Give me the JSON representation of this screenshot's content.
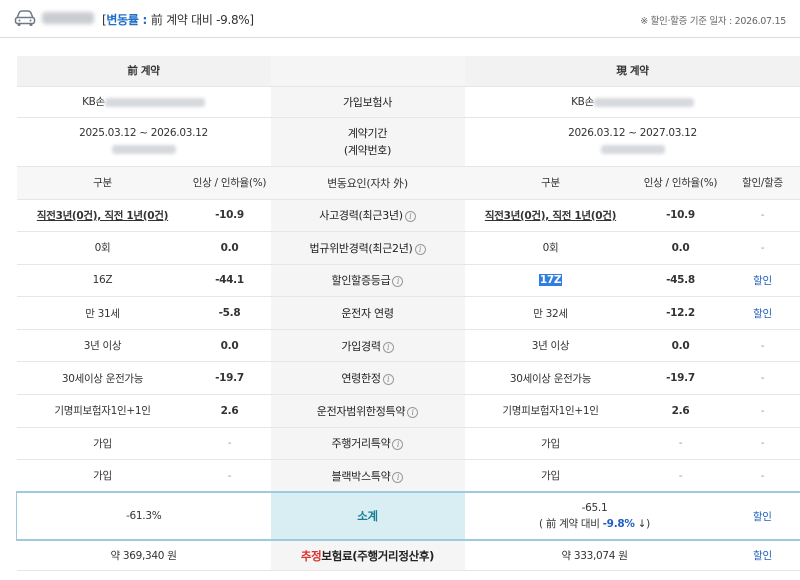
{
  "header": {
    "summary_open": "[",
    "rate_label": "변동률",
    "summary_colon": " : ",
    "summary_text": "前 계약 대비 -9.8%]",
    "basis": "※ 할인·할증 기준 일자 : 2026.07.15"
  },
  "contracts": {
    "prev_title": "前 계약",
    "curr_title": "現 계약",
    "insurer_label": "가입보험사",
    "prev_insurer": "KB손",
    "curr_insurer": "KB손",
    "period_label": "계약기간",
    "period_sublabel": "(계약번호)",
    "prev_period": "2025.03.12 ~ 2026.03.12",
    "curr_period": "2026.03.12 ~ 2027.03.12"
  },
  "columns": {
    "prev_category": "구분",
    "prev_rate": "인상 / 인하율(%)",
    "factor": "변동요인(자차 外)",
    "curr_category": "구분",
    "curr_rate": "인상 / 인하율(%)",
    "discount": "할인/할증"
  },
  "rows": [
    {
      "prev_value": "직전3년(0건), 직전 1년(0건)",
      "prev_rate": "-10.9",
      "factor": "사고경력(최근3년)",
      "curr_value": "직전3년(0건), 직전 1년(0건)",
      "curr_rate": "-10.9",
      "discount": "-"
    },
    {
      "prev_value": "0회",
      "prev_rate": "0.0",
      "factor": "법규위반경력(최근2년)",
      "curr_value": "0회",
      "curr_rate": "0.0",
      "discount": "-"
    },
    {
      "prev_value": "16Z",
      "prev_rate": "-44.1",
      "factor": "할인할증등급",
      "curr_value": "17Z",
      "curr_rate": "-45.8",
      "discount": "할인"
    },
    {
      "prev_value": "만 31세",
      "prev_rate": "-5.8",
      "factor": "운전자 연령",
      "curr_value": "만 32세",
      "curr_rate": "-12.2",
      "discount": "할인"
    },
    {
      "prev_value": "3년 이상",
      "prev_rate": "0.0",
      "factor": "가입경력",
      "curr_value": "3년 이상",
      "curr_rate": "0.0",
      "discount": "-"
    },
    {
      "prev_value": "30세이상 운전가능",
      "prev_rate": "-19.7",
      "factor": "연령한정",
      "curr_value": "30세이상 운전가능",
      "curr_rate": "-19.7",
      "discount": "-"
    },
    {
      "prev_value": "기명피보험자1인+1인",
      "prev_rate": "2.6",
      "factor": "운전자범위한정특약",
      "curr_value": "기명피보험자1인+1인",
      "curr_rate": "2.6",
      "discount": "-"
    },
    {
      "prev_value": "가입",
      "prev_rate": "-",
      "factor": "주행거리특약",
      "curr_value": "가입",
      "curr_rate": "-",
      "discount": "-"
    },
    {
      "prev_value": "가입",
      "prev_rate": "-",
      "factor": "블랙박스특약",
      "curr_value": "가입",
      "curr_rate": "-",
      "discount": "-"
    }
  ],
  "subtotal": {
    "prev": "-61.3%",
    "label": "소계",
    "curr": "-65.1",
    "curr_compare_prefix": "( 前 계약 대비 ",
    "curr_compare_value": "-9.8%",
    "curr_compare_suffix": " ↓)",
    "discount": "할인"
  },
  "premium": {
    "prev": "약 369,340 원",
    "label_red": "추정",
    "label_rest": "보험료(주행거리정산후)",
    "curr": "약 333,074 원",
    "discount": "할인"
  },
  "colors": {
    "accent_blue": "#1f6fc5",
    "subtotal_bg": "#d8eef3",
    "subtotal_border": "#9ec9de",
    "red": "#e03030"
  },
  "icons": {
    "car": "car-icon",
    "info": "info-circle-icon"
  }
}
